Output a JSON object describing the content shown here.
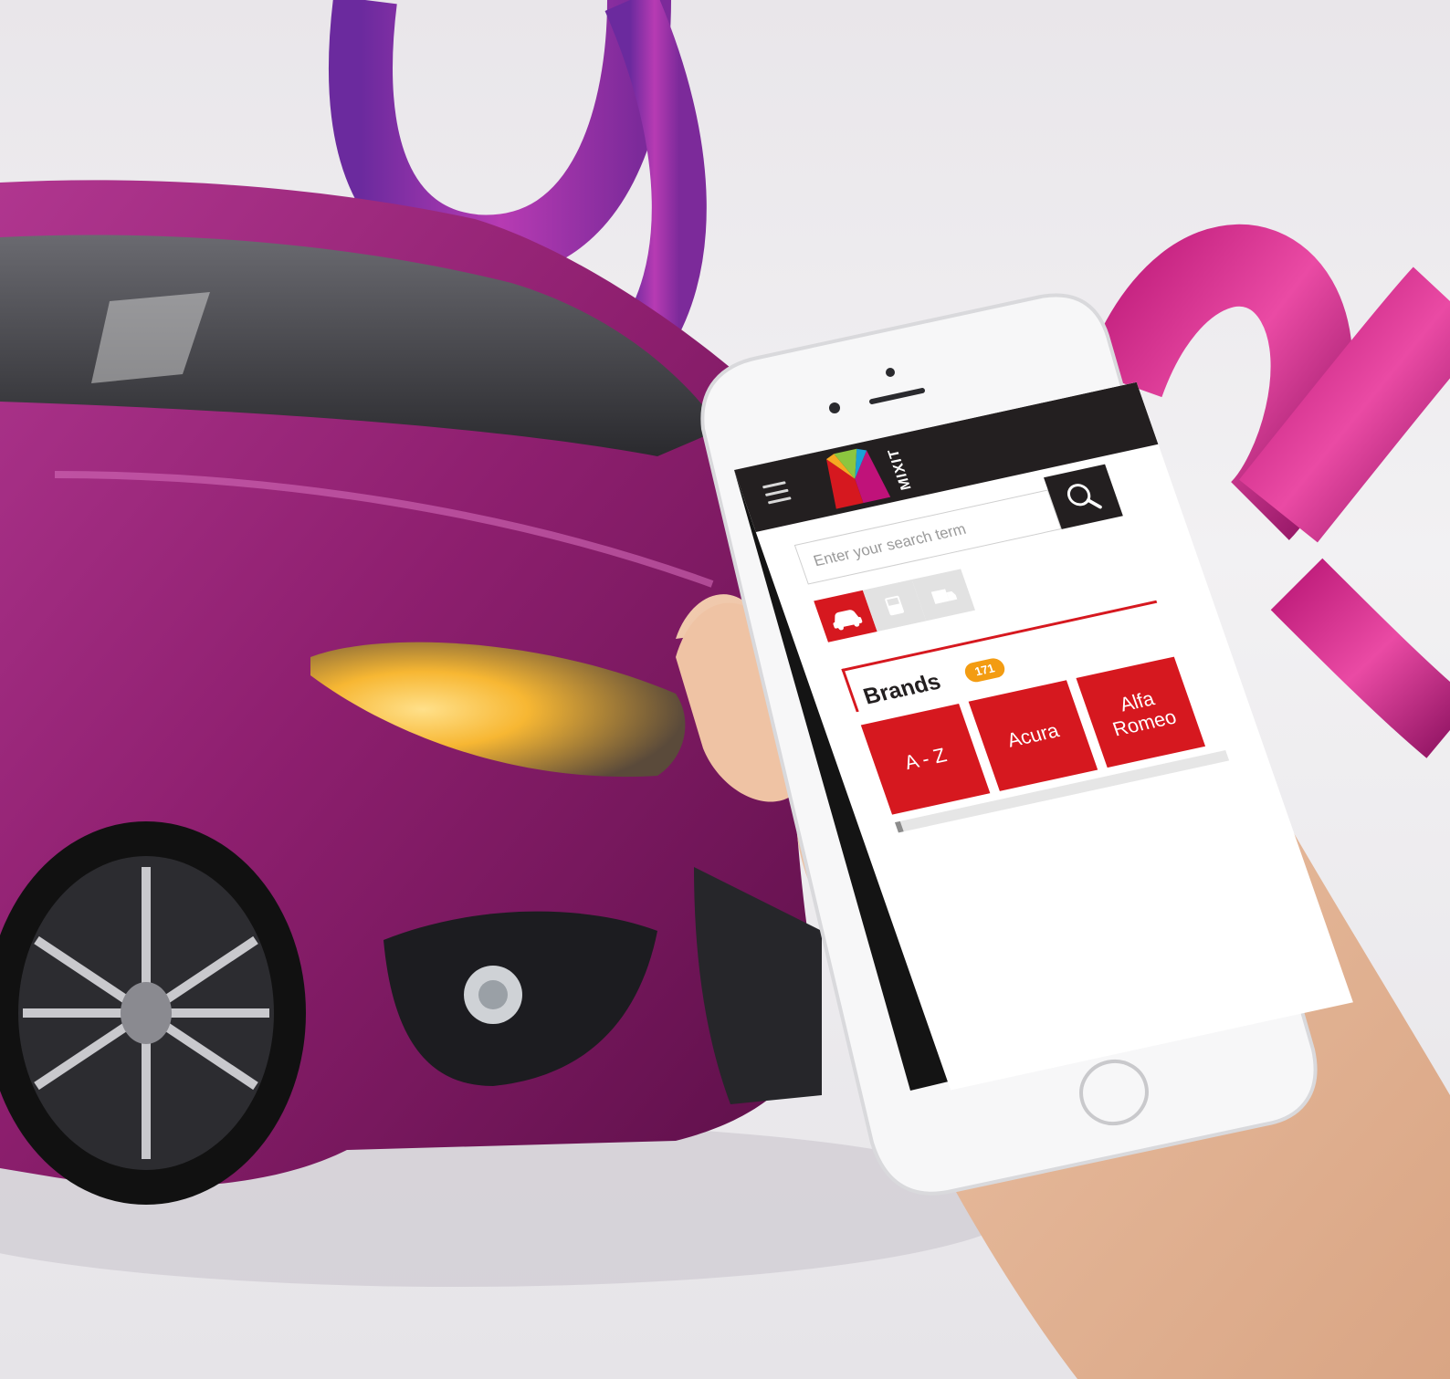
{
  "app": {
    "logo_text": "MIXIT",
    "search": {
      "placeholder": "Enter your search term"
    },
    "category_tabs": [
      {
        "icon": "car-icon",
        "active": true
      },
      {
        "icon": "bus-icon",
        "active": false
      },
      {
        "icon": "truck-icon",
        "active": false
      }
    ],
    "brands": {
      "title": "Brands",
      "count": "171",
      "tiles": [
        "A - Z",
        "Acura",
        "Alfa Romeo"
      ]
    }
  },
  "colors": {
    "accent": "#d6181f",
    "header": "#231f20",
    "badge": "#f39c12",
    "car_body": "#8e1f6f"
  }
}
